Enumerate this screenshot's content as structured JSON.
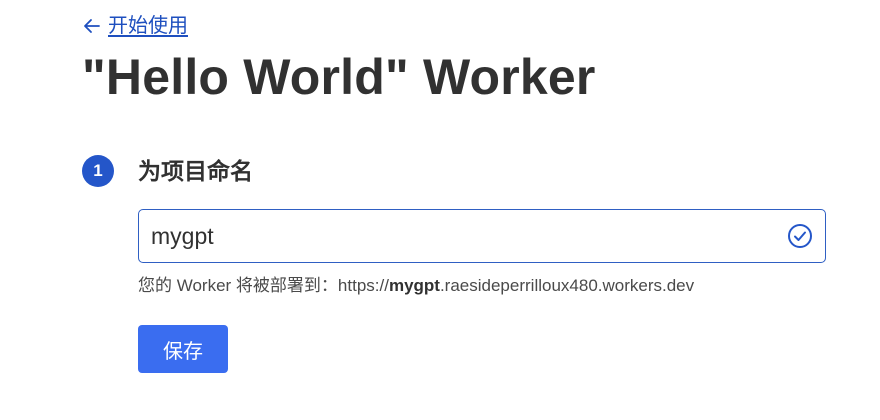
{
  "back_link": {
    "label": "开始使用",
    "icon": "arrow-left-icon"
  },
  "page_title": "\"Hello World\" Worker",
  "step": {
    "number": "1",
    "title": "为项目命名"
  },
  "name_field": {
    "value": "mygpt",
    "status_icon": "check-circle-icon"
  },
  "helper": {
    "prefix": "您的 Worker 将被部署到：https://",
    "subdomain": "mygpt",
    "suffix": ".raesideperrilloux480.workers.dev"
  },
  "save_button": {
    "label": "保存"
  },
  "colors": {
    "accent": "#2456c9",
    "button": "#3a6df0",
    "text": "#313131"
  }
}
